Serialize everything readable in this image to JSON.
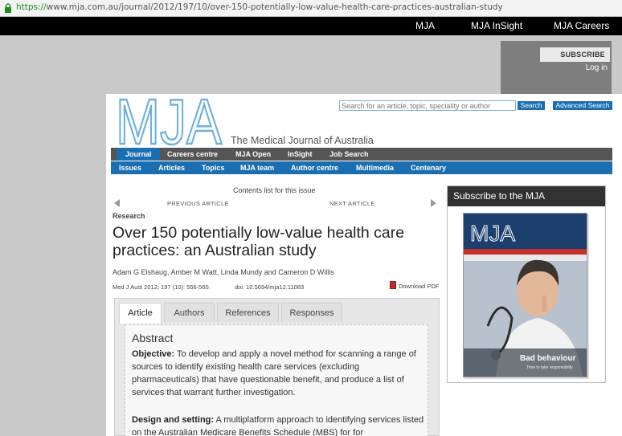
{
  "browser": {
    "url_scheme": "https://",
    "url_rest": "www.mja.com.au/journal/2012/197/10/over-150-potentially-low-value-health-care-practices-australian-study"
  },
  "sitebar": {
    "links": [
      "MJA",
      "MJA InSight",
      "MJA Careers"
    ]
  },
  "account": {
    "subscribe_label": "SUBSCRIBE",
    "login_label": "Log in"
  },
  "header": {
    "logo_text": "MJA",
    "tagline": "The Medical Journal of Australia",
    "search_placeholder": "Search for an article, topic, speciality or author",
    "search_button": "Search",
    "advanced_search_button": "Advanced Search"
  },
  "nav": {
    "primary": [
      "Journal",
      "Careers centre",
      "MJA Open",
      "InSight",
      "Job Search"
    ],
    "secondary": [
      "Issues",
      "Articles",
      "Topics",
      "MJA team",
      "Author centre",
      "Multimedia",
      "Centenary"
    ]
  },
  "article": {
    "contents_link": "Contents list for this issue",
    "previous_label": "PREVIOUS ARTICLE",
    "next_label": "NEXT ARTICLE",
    "section": "Research",
    "title": "Over 150 potentially low-value health care practices: an Australian study",
    "authors": "Adam G Elshaug, Amber M Watt, Linda Mundy and Cameron D Willis",
    "citation": "Med J Aust 2012; 197 (10): 556-560.",
    "doi": "doi: 10.5694/mja12.11083",
    "pdf_label": "Download PDF",
    "tabs": [
      "Article",
      "Authors",
      "References",
      "Responses"
    ],
    "abstract_heading": "Abstract",
    "objective_label": "Objective:",
    "objective_text": "To develop and apply a novel method for scanning a range of sources to identify existing health care services (excluding pharmaceuticals) that have questionable benefit, and produce a list of services that warrant further investigation.",
    "design_label": "Design and setting:",
    "design_text": "A multiplatform approach to identifying services listed on the Australian Medicare Benefits Schedule (MBS) for for"
  },
  "sidebar": {
    "heading": "Subscribe to the MJA",
    "cover_logo": "MJA",
    "cover_caption": "Bad behaviour",
    "cover_subcaption": "Time to take responsibility"
  },
  "colors": {
    "brand_blue": "#1b6fb0",
    "logo_blue": "#6fb1db"
  }
}
